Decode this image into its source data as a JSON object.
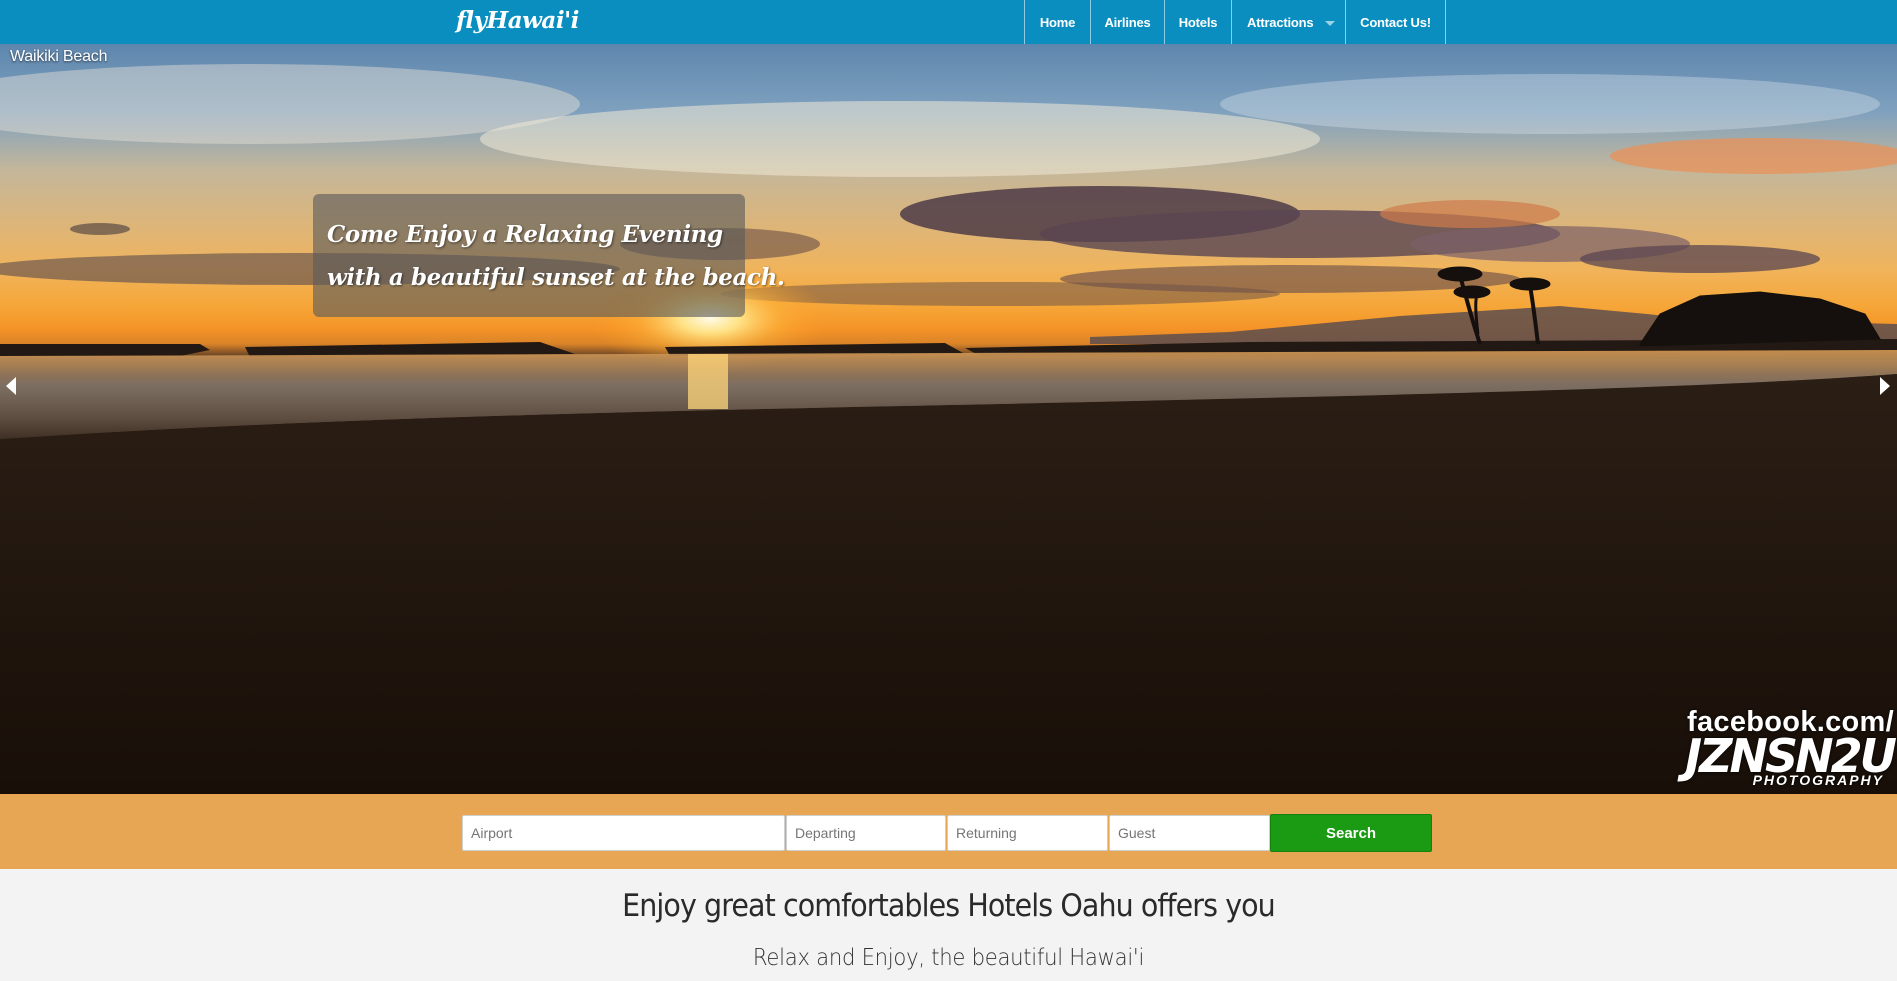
{
  "navbar": {
    "brand": "flyHawai'i",
    "items": [
      {
        "label": "Home"
      },
      {
        "label": "Airlines"
      },
      {
        "label": "Hotels"
      },
      {
        "label": "Attractions",
        "has_dropdown": true
      },
      {
        "label": "Contact Us!"
      }
    ],
    "background_color": "#0a8ec0"
  },
  "hero": {
    "slide_caption": "Waikiki Beach",
    "promo_lines": [
      "Come Enjoy a Relaxing Evening",
      "with a beautiful sunset at the beach."
    ],
    "watermark": {
      "line1": "facebook.com/",
      "line2": "JZNSN2U",
      "line3": "PHOTOGRAPHY"
    },
    "prev_icon": "triangle-left",
    "next_icon": "triangle-right"
  },
  "search": {
    "airport_placeholder": "Airport",
    "departing_placeholder": "Departing",
    "returning_placeholder": "Returning",
    "guest_placeholder": "Guest",
    "button_label": "Search",
    "band_color": "#e6a653",
    "button_color": "#1b9a14"
  },
  "content": {
    "headline": "Enjoy great comfortables Hotels Oahu offers you",
    "subheadline": "Relax and Enjoy, the beautiful Hawai'i"
  }
}
